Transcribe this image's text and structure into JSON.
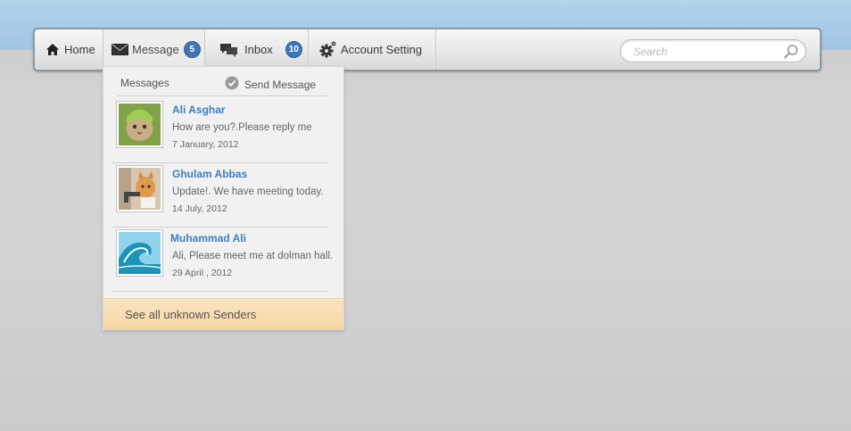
{
  "nav": {
    "home": {
      "label": "Home",
      "icon": "home-icon"
    },
    "message": {
      "label": "Message",
      "badge": "5",
      "icon": "envelope-icon"
    },
    "inbox": {
      "label": "Inbox",
      "badge": "10",
      "icon": "chat-bubbles-icon"
    },
    "account": {
      "label": "Account Setting",
      "icon": "gear-icon"
    }
  },
  "search": {
    "placeholder": "Search",
    "value": ""
  },
  "dropdown": {
    "title": "Messages",
    "send_label": "Send Message",
    "messages": [
      {
        "sender": "Ali Asghar",
        "text": "How are you?.Please reply me",
        "date": "7 January, 2012"
      },
      {
        "sender": "Ghulam Abbas",
        "text": "Update!. We have meeting today.",
        "date": "14 July, 2012"
      },
      {
        "sender": "Muhammad Ali",
        "text": "Ali, Please meet me at dolman hall.",
        "date": "29 April , 2012"
      }
    ],
    "footer": "See all unknown Senders"
  },
  "colors": {
    "accent": "#3d7fc2",
    "badge": "#3f77b6",
    "footer": "#f6d6a6",
    "topband": "#b4d3ec"
  }
}
